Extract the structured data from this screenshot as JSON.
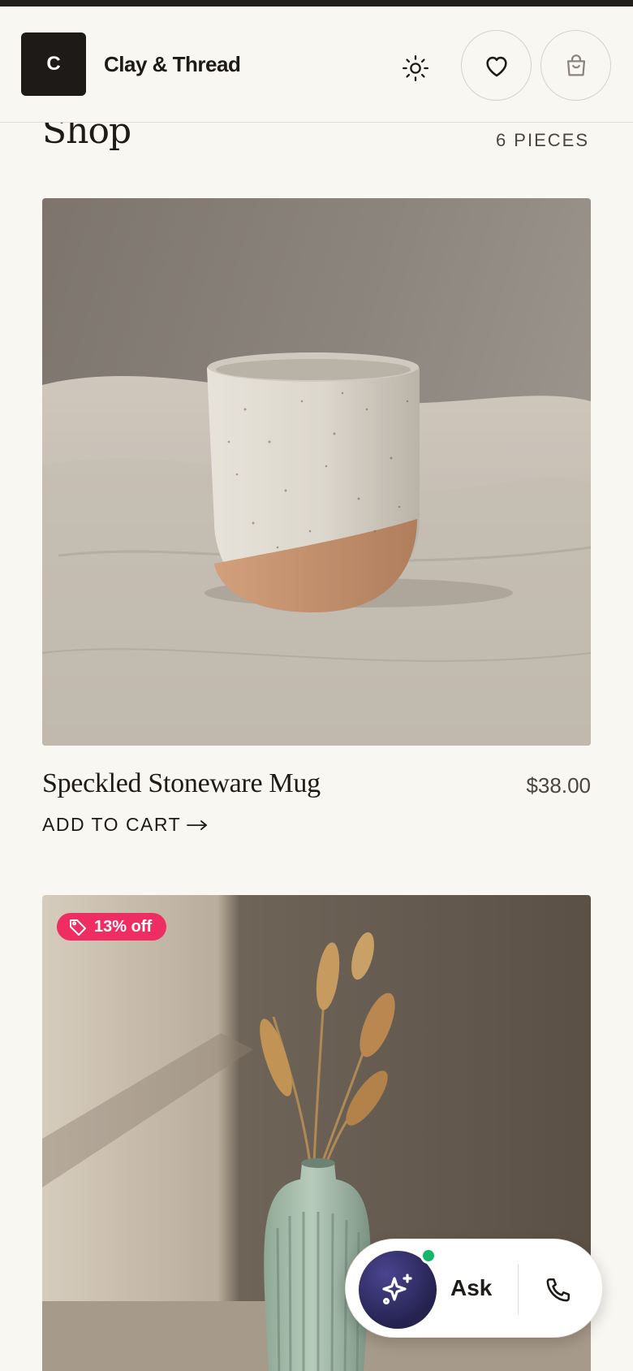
{
  "header": {
    "logo_letter": "C",
    "brand_name": "Clay & Thread",
    "icons": {
      "theme": "sun-icon",
      "favorites": "heart-icon",
      "cart": "shopping-bag-icon"
    }
  },
  "shop": {
    "title": "Shop",
    "count": "6 PIECES"
  },
  "products": [
    {
      "name": "Speckled Stoneware Mug",
      "price": "$38.00",
      "action": "ADD TO CART",
      "action_icon": "arrow-right-icon",
      "image": "speckled-mug-photo"
    },
    {
      "badge": "13% off",
      "badge_icon": "tag-icon",
      "image": "sage-vase-with-dried-wheat-photo"
    }
  ],
  "assistant": {
    "ask_label": "Ask",
    "ask_icon": "sparkles-icon",
    "call_icon": "phone-icon",
    "status": "online"
  },
  "colors": {
    "background": "#f9f7f2",
    "ink": "#1d1a17",
    "badge": "#ee2d62",
    "orb": "#2f2b63",
    "online": "#12b76a"
  }
}
